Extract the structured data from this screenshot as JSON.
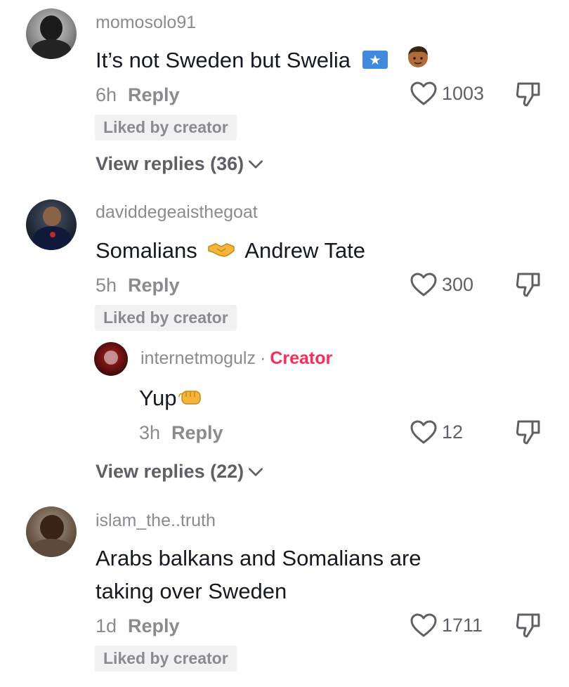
{
  "comments": [
    {
      "username": "momosolo91",
      "text": "It’s not Sweden but Swelia",
      "emojis": [
        "somalia-flag-icon",
        "boy-emoji-icon"
      ],
      "time": "6h",
      "reply_label": "Reply",
      "likes": "1003",
      "liked_badge": "Liked by creator",
      "view_replies": "View replies (36)"
    },
    {
      "username": "daviddegeaisthegoat",
      "text_before": "Somalians",
      "text_after": "Andrew Tate",
      "emoji": "handshake-icon",
      "time": "5h",
      "reply_label": "Reply",
      "likes": "300",
      "liked_badge": "Liked by creator",
      "reply": {
        "username": "internetmogulz",
        "separator": "·",
        "badge": "Creator",
        "text": "Yup",
        "emoji": "fist-bump-icon",
        "time": "3h",
        "reply_label": "Reply",
        "likes": "12"
      },
      "view_replies": "View replies (22)"
    },
    {
      "username": "islam_the..truth",
      "text_line1": "Arabs balkans and Somalians are",
      "text_line2": "taking over Sweden",
      "time": "1d",
      "reply_label": "Reply",
      "likes": "1711",
      "liked_badge": "Liked by creator"
    }
  ],
  "colors": {
    "primary_text": "#161823",
    "secondary_text": "#8a8b91",
    "creator_accent": "#fe2c55",
    "badge_bg": "#f1f1f2"
  }
}
